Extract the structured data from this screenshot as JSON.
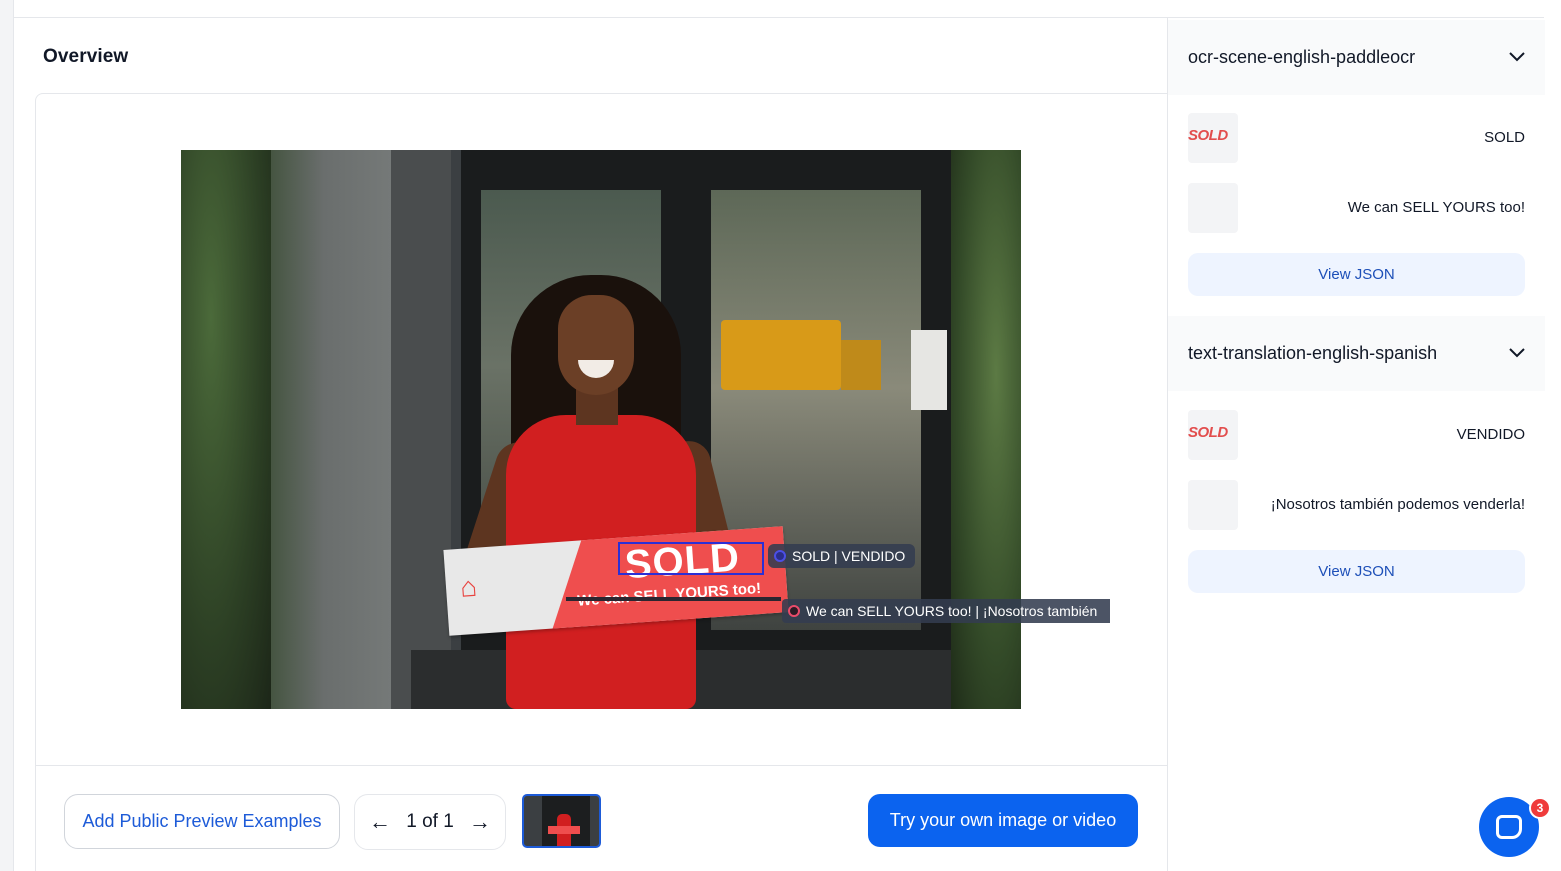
{
  "overview": {
    "title": "Overview"
  },
  "image": {
    "sign_text": "SOLD",
    "sign_subtext": "We can SELL YOURS too!"
  },
  "detections": [
    {
      "label": "SOLD | VENDIDO"
    },
    {
      "label": "We can SELL YOURS too! | ¡Nosotros también"
    }
  ],
  "footer": {
    "add_examples_label": "Add Public Preview Examples",
    "pager": {
      "prev_icon": "arrow-left-icon",
      "text": "1 of 1",
      "next_icon": "arrow-right-icon"
    },
    "try_label": "Try your own image or video"
  },
  "right_panel": {
    "sections": [
      {
        "title": "ocr-scene-english-paddleocr",
        "rows": [
          {
            "thumb_text": "SOLD",
            "text": "SOLD"
          },
          {
            "thumb_text": "",
            "text": "We can SELL YOURS too!"
          }
        ],
        "json_label": "View JSON"
      },
      {
        "title": "text-translation-english-spanish",
        "rows": [
          {
            "thumb_text": "SOLD",
            "text": "VENDIDO"
          },
          {
            "thumb_text": "",
            "text": "¡Nosotros también podemos venderla!"
          }
        ],
        "json_label": "View JSON"
      }
    ]
  },
  "chat": {
    "badge_count": "3"
  },
  "colors": {
    "primary": "#0b63ef",
    "link": "#1d5bd8",
    "box": "#2b2fd6",
    "badge": "#ef3b3b"
  }
}
